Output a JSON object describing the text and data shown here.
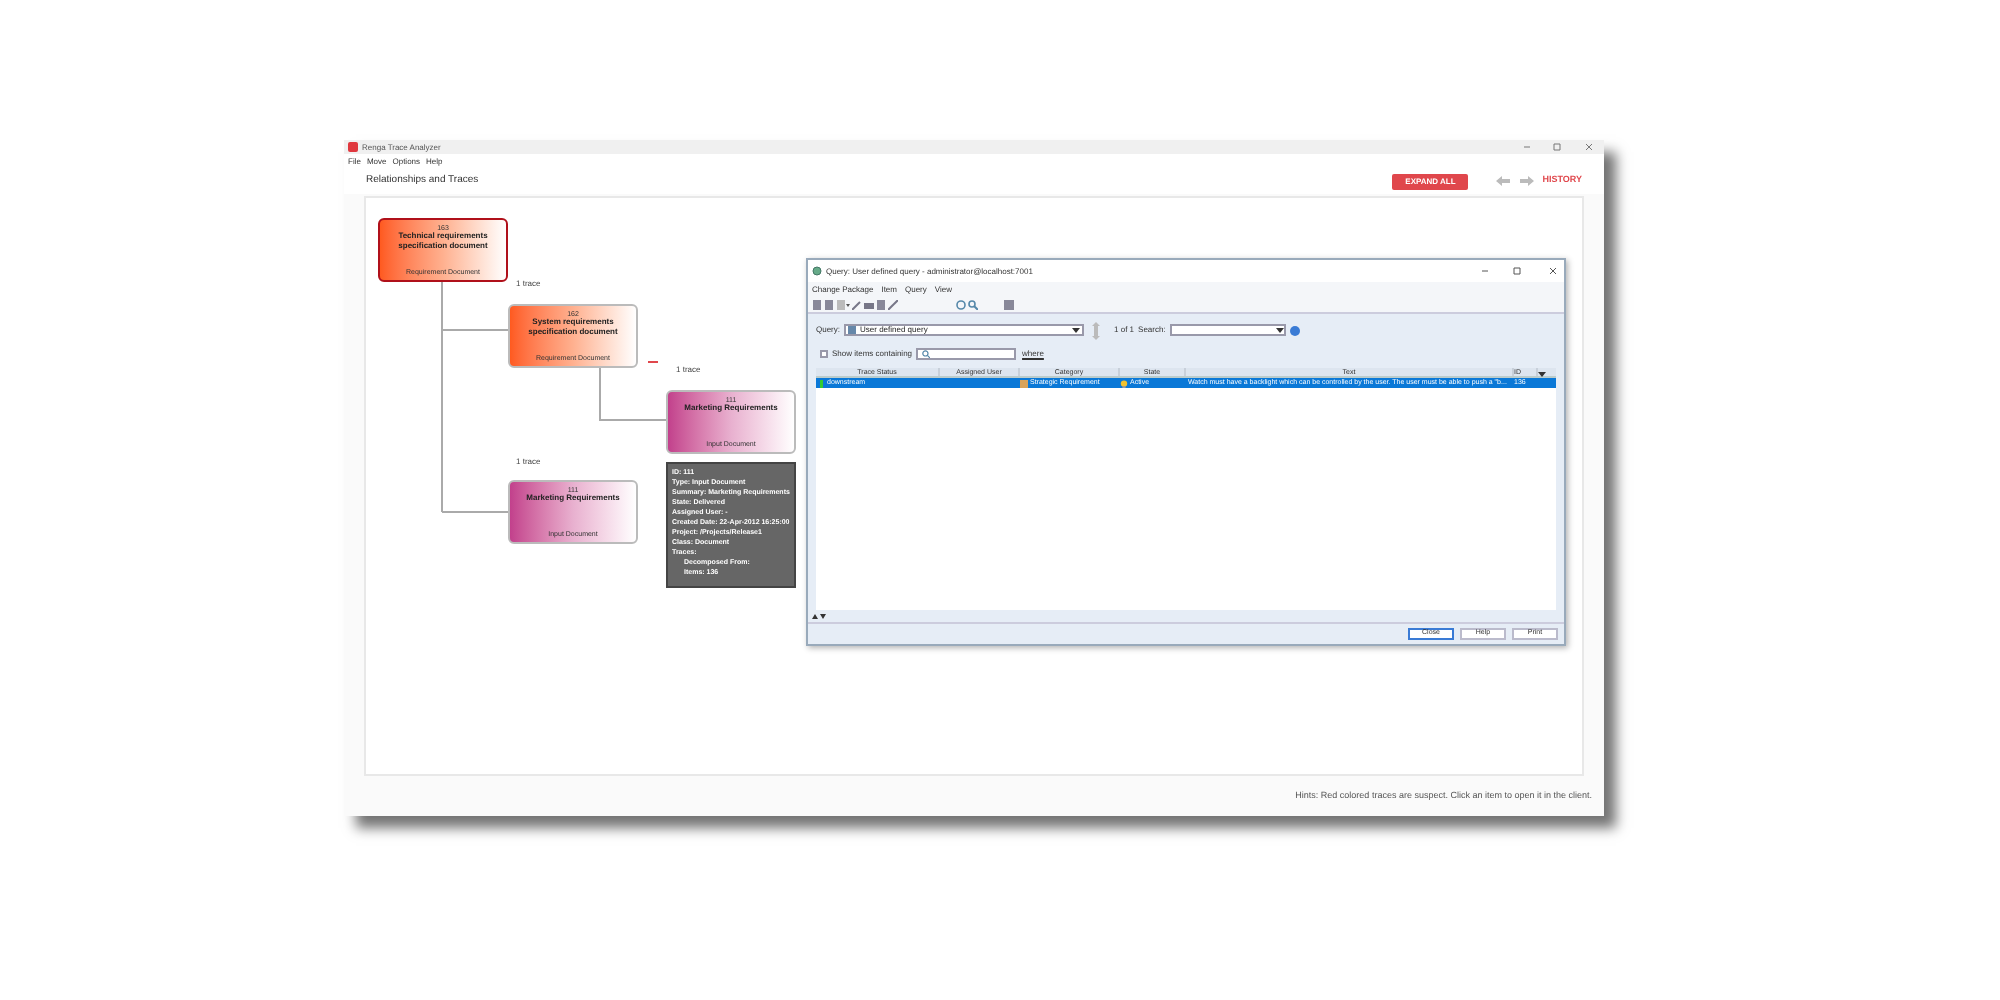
{
  "app": {
    "title": "Renga Trace Analyzer",
    "menu": [
      "File",
      "Move",
      "Options",
      "Help"
    ],
    "heading": "Relationships and Traces",
    "expand_button": "EXPAND ALL",
    "history_link": "HISTORY"
  },
  "nodes": [
    {
      "id": "163",
      "title": "Technical requirements specification document",
      "type": "Requirement Document",
      "kind": "requirement",
      "selected": true
    },
    {
      "id": "162",
      "title": "System requirements specification document",
      "type": "Requirement Document",
      "kind": "requirement",
      "selected": false
    },
    {
      "id": "111",
      "title": "Marketing Requirements",
      "type": "Input Document",
      "kind": "input",
      "selected": false
    },
    {
      "id": "111",
      "title": "Marketing Requirements",
      "type": "Input Document",
      "kind": "input",
      "selected": false
    }
  ],
  "trace_labels": [
    "1 trace",
    "1 trace",
    "1 trace"
  ],
  "tooltip": {
    "lines": [
      {
        "text": "ID: 111"
      },
      {
        "text": "Type: Input Document"
      },
      {
        "text": "Summary: Marketing Requirements"
      },
      {
        "text": "State: Delivered"
      },
      {
        "text": "Assigned User: -"
      },
      {
        "text": "Created Date: 22-Apr-2012 16:25:00"
      },
      {
        "text": "Project: /Projects/Release1"
      },
      {
        "text": "Class: Document"
      },
      {
        "text": "Traces:",
        "children": [
          {
            "text": "Decomposed From:"
          },
          {
            "text": "Items: 136"
          }
        ]
      }
    ]
  },
  "dialog": {
    "title": "Query: User defined query - administrator@localhost:7001",
    "menu": [
      "Change Package",
      "Item",
      "Query",
      "View"
    ],
    "query_label": "Query:",
    "query_value": "User defined query",
    "count": "1 of 1",
    "search_label": "Search:",
    "show_items": {
      "label": "Show items containing",
      "checked": false
    },
    "where_button": "where",
    "columns": [
      "Trace Status",
      "Assigned User",
      "Category",
      "State",
      "Text",
      "ID"
    ],
    "rows": [
      {
        "trace_status": "downstream",
        "category": "Strategic Requirement",
        "state": "Active",
        "text": "Watch must have a backlight which can be controlled by the user. The user must be able to push a \"b...",
        "id": "136",
        "selected": true
      }
    ],
    "buttons": [
      "Close",
      "Help",
      "Print"
    ]
  },
  "hints": "Hints: Red colored traces are suspect. Click an item to open it in the client."
}
